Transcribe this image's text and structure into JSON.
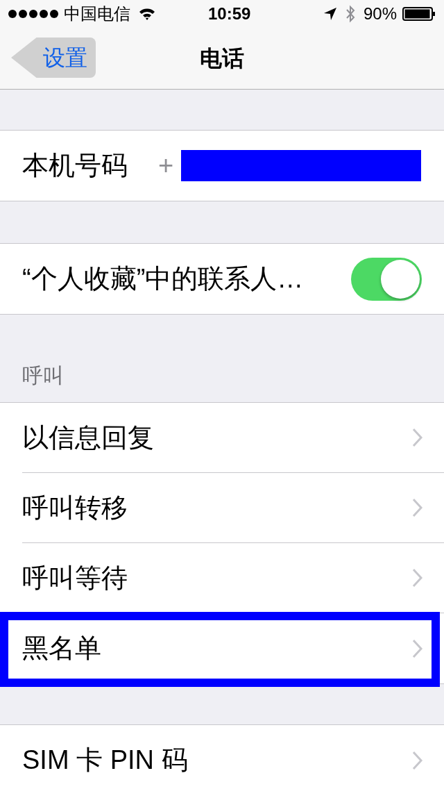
{
  "status_bar": {
    "carrier": "中国电信",
    "time": "10:59",
    "battery": "90%"
  },
  "nav": {
    "back": "设置",
    "title": "电话"
  },
  "sections": [
    {
      "rows": [
        {
          "kind": "value",
          "label": "本机号码",
          "value": "+",
          "redacted": true
        }
      ]
    },
    {
      "rows": [
        {
          "kind": "toggle",
          "label": "“个人收藏”中的联系人…",
          "on": true
        }
      ]
    },
    {
      "header": "呼叫",
      "rows": [
        {
          "kind": "link",
          "label": "以信息回复",
          "highlighted": false
        },
        {
          "kind": "link",
          "label": "呼叫转移",
          "highlighted": false
        },
        {
          "kind": "link",
          "label": "呼叫等待",
          "highlighted": false
        },
        {
          "kind": "link",
          "label": "黑名单",
          "highlighted": true
        }
      ]
    },
    {
      "rows": [
        {
          "kind": "link",
          "label": "SIM 卡 PIN 码",
          "highlighted": false
        }
      ]
    }
  ]
}
